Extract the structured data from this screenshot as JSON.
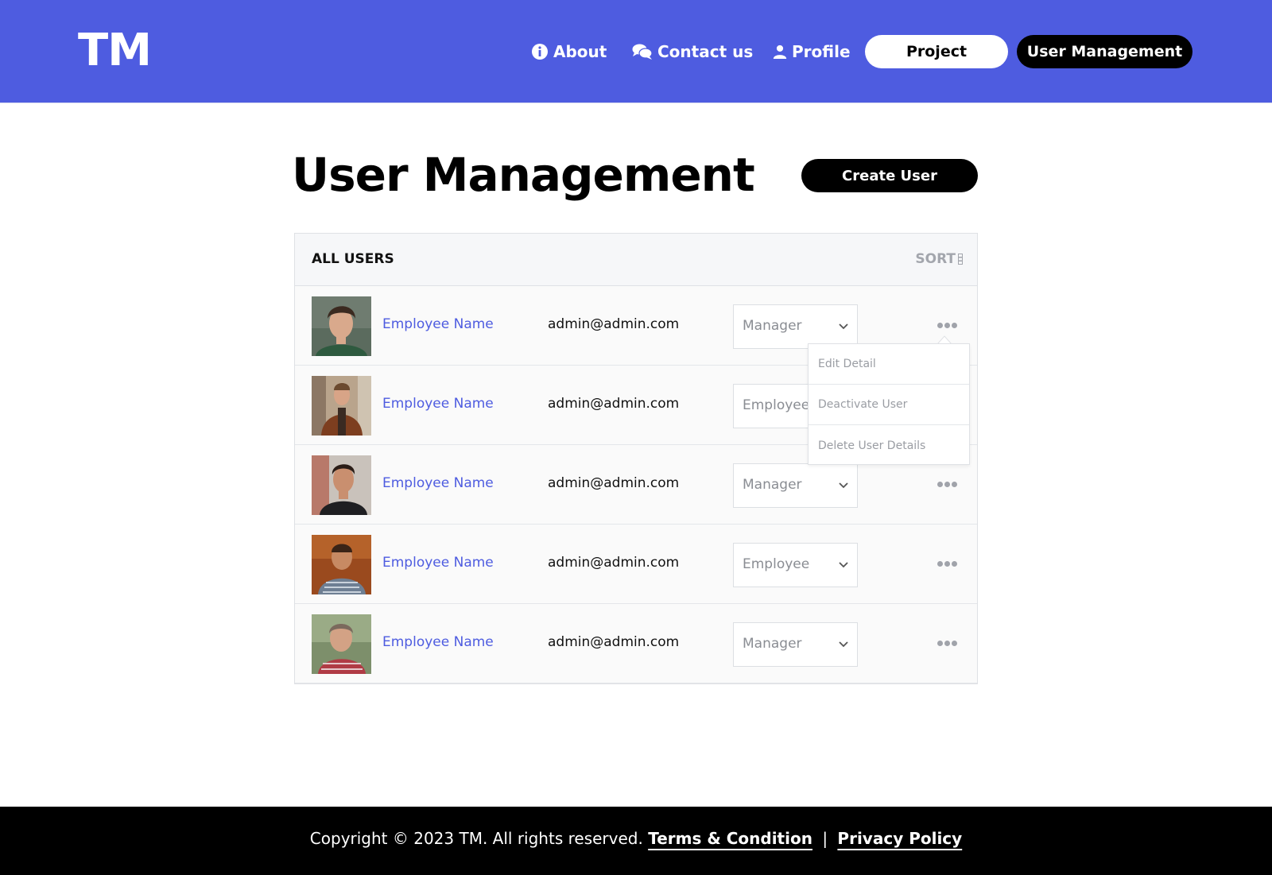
{
  "header": {
    "logo": "TM",
    "nav": {
      "about": "About",
      "contact": "Contact us",
      "profile": "Profile",
      "project": "Project",
      "user_management": "User Management"
    }
  },
  "page": {
    "title": "User Management",
    "create_button": "Create User"
  },
  "table": {
    "heading": "ALL USERS",
    "sort_label": "SORT",
    "rows": [
      {
        "name": "Employee Name",
        "email": "admin@admin.com",
        "role": "Manager"
      },
      {
        "name": "Employee Name",
        "email": "admin@admin.com",
        "role": "Employee"
      },
      {
        "name": "Employee Name",
        "email": "admin@admin.com",
        "role": "Manager"
      },
      {
        "name": "Employee Name",
        "email": "admin@admin.com",
        "role": "Employee"
      },
      {
        "name": "Employee Name",
        "email": "admin@admin.com",
        "role": "Manager"
      }
    ]
  },
  "row_menu": {
    "items": [
      "Edit Detail",
      "Deactivate User",
      "Delete User Details"
    ]
  },
  "footer": {
    "copyright": "Copyright ©  2023 TM. All rights reserved.",
    "terms": "Terms & Condition",
    "separator": "|",
    "privacy": "Privacy Policy"
  },
  "colors": {
    "brand": "#4e5ce0",
    "dark": "#000000"
  }
}
